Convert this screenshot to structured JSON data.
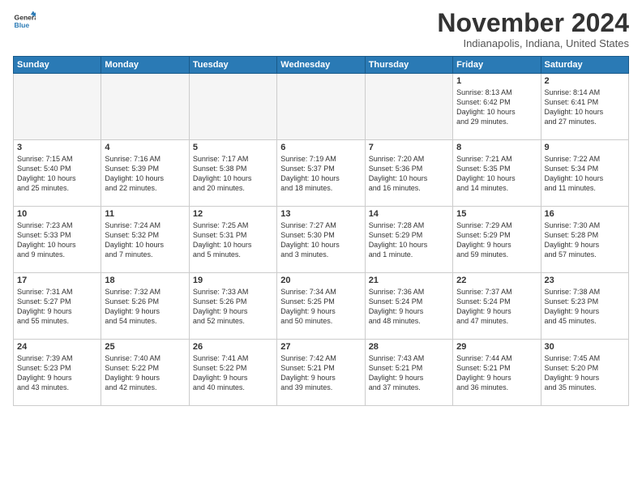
{
  "logo": {
    "line1": "General",
    "line2": "Blue"
  },
  "title": "November 2024",
  "location": "Indianapolis, Indiana, United States",
  "weekdays": [
    "Sunday",
    "Monday",
    "Tuesday",
    "Wednesday",
    "Thursday",
    "Friday",
    "Saturday"
  ],
  "weeks": [
    [
      {
        "day": "",
        "info": ""
      },
      {
        "day": "",
        "info": ""
      },
      {
        "day": "",
        "info": ""
      },
      {
        "day": "",
        "info": ""
      },
      {
        "day": "",
        "info": ""
      },
      {
        "day": "1",
        "info": "Sunrise: 8:13 AM\nSunset: 6:42 PM\nDaylight: 10 hours\nand 29 minutes."
      },
      {
        "day": "2",
        "info": "Sunrise: 8:14 AM\nSunset: 6:41 PM\nDaylight: 10 hours\nand 27 minutes."
      }
    ],
    [
      {
        "day": "3",
        "info": "Sunrise: 7:15 AM\nSunset: 5:40 PM\nDaylight: 10 hours\nand 25 minutes."
      },
      {
        "day": "4",
        "info": "Sunrise: 7:16 AM\nSunset: 5:39 PM\nDaylight: 10 hours\nand 22 minutes."
      },
      {
        "day": "5",
        "info": "Sunrise: 7:17 AM\nSunset: 5:38 PM\nDaylight: 10 hours\nand 20 minutes."
      },
      {
        "day": "6",
        "info": "Sunrise: 7:19 AM\nSunset: 5:37 PM\nDaylight: 10 hours\nand 18 minutes."
      },
      {
        "day": "7",
        "info": "Sunrise: 7:20 AM\nSunset: 5:36 PM\nDaylight: 10 hours\nand 16 minutes."
      },
      {
        "day": "8",
        "info": "Sunrise: 7:21 AM\nSunset: 5:35 PM\nDaylight: 10 hours\nand 14 minutes."
      },
      {
        "day": "9",
        "info": "Sunrise: 7:22 AM\nSunset: 5:34 PM\nDaylight: 10 hours\nand 11 minutes."
      }
    ],
    [
      {
        "day": "10",
        "info": "Sunrise: 7:23 AM\nSunset: 5:33 PM\nDaylight: 10 hours\nand 9 minutes."
      },
      {
        "day": "11",
        "info": "Sunrise: 7:24 AM\nSunset: 5:32 PM\nDaylight: 10 hours\nand 7 minutes."
      },
      {
        "day": "12",
        "info": "Sunrise: 7:25 AM\nSunset: 5:31 PM\nDaylight: 10 hours\nand 5 minutes."
      },
      {
        "day": "13",
        "info": "Sunrise: 7:27 AM\nSunset: 5:30 PM\nDaylight: 10 hours\nand 3 minutes."
      },
      {
        "day": "14",
        "info": "Sunrise: 7:28 AM\nSunset: 5:29 PM\nDaylight: 10 hours\nand 1 minute."
      },
      {
        "day": "15",
        "info": "Sunrise: 7:29 AM\nSunset: 5:29 PM\nDaylight: 9 hours\nand 59 minutes."
      },
      {
        "day": "16",
        "info": "Sunrise: 7:30 AM\nSunset: 5:28 PM\nDaylight: 9 hours\nand 57 minutes."
      }
    ],
    [
      {
        "day": "17",
        "info": "Sunrise: 7:31 AM\nSunset: 5:27 PM\nDaylight: 9 hours\nand 55 minutes."
      },
      {
        "day": "18",
        "info": "Sunrise: 7:32 AM\nSunset: 5:26 PM\nDaylight: 9 hours\nand 54 minutes."
      },
      {
        "day": "19",
        "info": "Sunrise: 7:33 AM\nSunset: 5:26 PM\nDaylight: 9 hours\nand 52 minutes."
      },
      {
        "day": "20",
        "info": "Sunrise: 7:34 AM\nSunset: 5:25 PM\nDaylight: 9 hours\nand 50 minutes."
      },
      {
        "day": "21",
        "info": "Sunrise: 7:36 AM\nSunset: 5:24 PM\nDaylight: 9 hours\nand 48 minutes."
      },
      {
        "day": "22",
        "info": "Sunrise: 7:37 AM\nSunset: 5:24 PM\nDaylight: 9 hours\nand 47 minutes."
      },
      {
        "day": "23",
        "info": "Sunrise: 7:38 AM\nSunset: 5:23 PM\nDaylight: 9 hours\nand 45 minutes."
      }
    ],
    [
      {
        "day": "24",
        "info": "Sunrise: 7:39 AM\nSunset: 5:23 PM\nDaylight: 9 hours\nand 43 minutes."
      },
      {
        "day": "25",
        "info": "Sunrise: 7:40 AM\nSunset: 5:22 PM\nDaylight: 9 hours\nand 42 minutes."
      },
      {
        "day": "26",
        "info": "Sunrise: 7:41 AM\nSunset: 5:22 PM\nDaylight: 9 hours\nand 40 minutes."
      },
      {
        "day": "27",
        "info": "Sunrise: 7:42 AM\nSunset: 5:21 PM\nDaylight: 9 hours\nand 39 minutes."
      },
      {
        "day": "28",
        "info": "Sunrise: 7:43 AM\nSunset: 5:21 PM\nDaylight: 9 hours\nand 37 minutes."
      },
      {
        "day": "29",
        "info": "Sunrise: 7:44 AM\nSunset: 5:21 PM\nDaylight: 9 hours\nand 36 minutes."
      },
      {
        "day": "30",
        "info": "Sunrise: 7:45 AM\nSunset: 5:20 PM\nDaylight: 9 hours\nand 35 minutes."
      }
    ]
  ]
}
